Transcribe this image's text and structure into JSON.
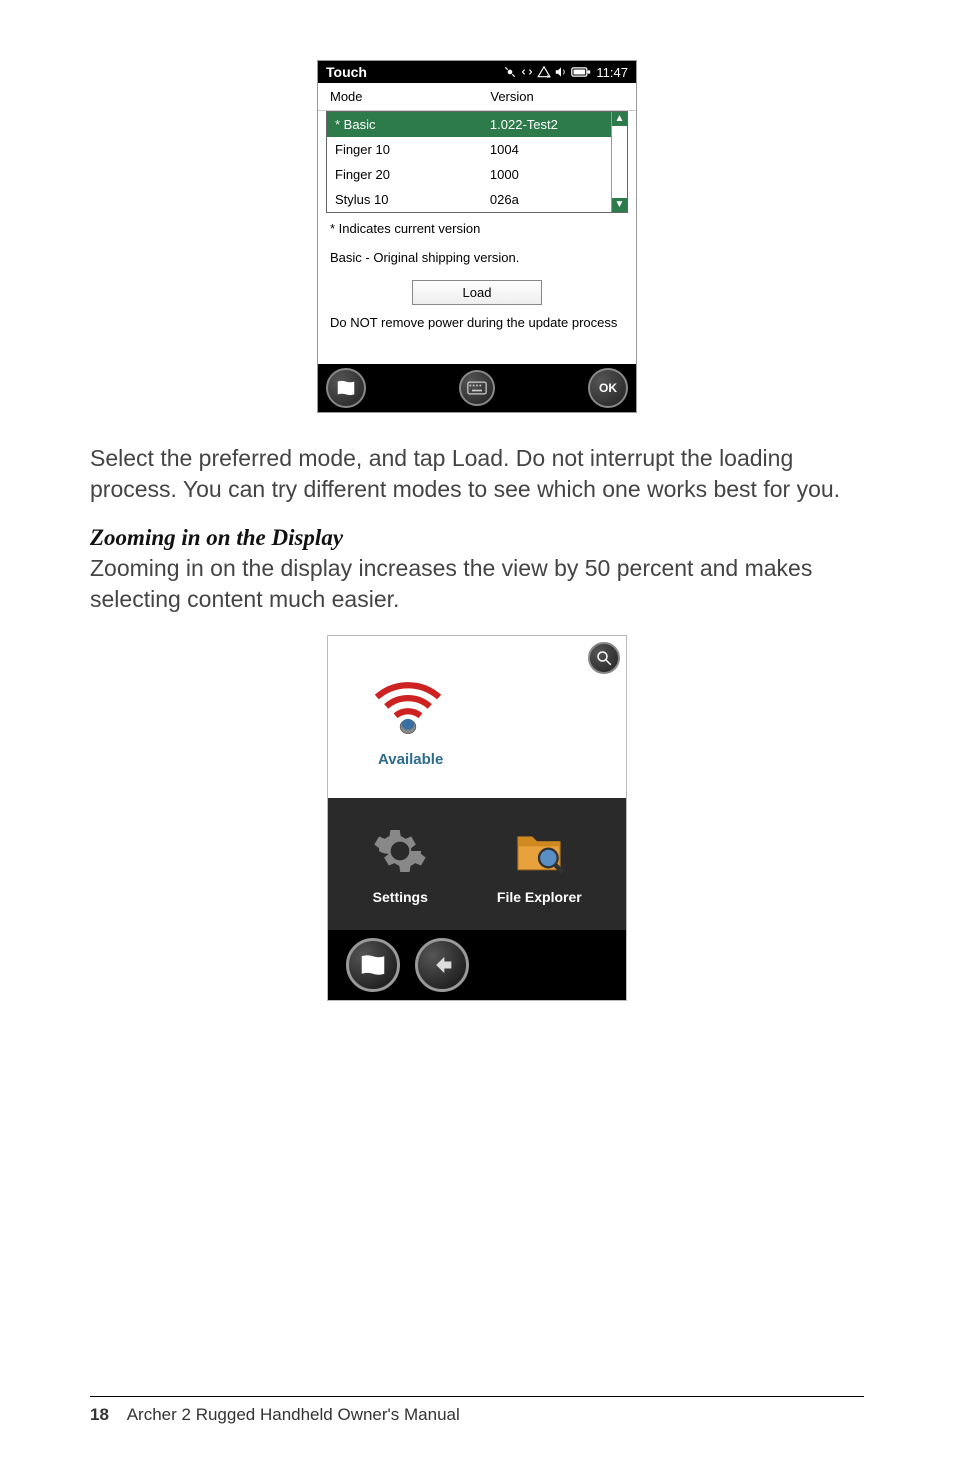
{
  "screenshot1": {
    "title": "Touch",
    "time": "11:47",
    "columns": {
      "mode": "Mode",
      "version": "Version"
    },
    "rows": [
      {
        "mode": "* Basic",
        "version": "1.022-Test2",
        "selected": true
      },
      {
        "mode": "Finger 10",
        "version": "1004",
        "selected": false
      },
      {
        "mode": "Finger 20",
        "version": "1000",
        "selected": false
      },
      {
        "mode": "Stylus 10",
        "version": "026a",
        "selected": false
      }
    ],
    "note1": "* Indicates current version",
    "note2": "Basic - Original shipping version.",
    "load": "Load",
    "warning": "Do NOT remove power during the update process",
    "ok": "OK"
  },
  "body": {
    "para1": "Select the preferred mode, and tap Load. Do not interrupt the loading process. You can try different modes to see which one works best for you.",
    "heading": "Zooming in on the Display",
    "para2": "Zooming in on the display increases the view by 50 percent and makes selecting content much easier."
  },
  "screenshot2": {
    "wifi_label": "Available",
    "tiles": {
      "settings": "Settings",
      "explorer": "File Explorer"
    }
  },
  "footer": {
    "page": "18",
    "doc": "Archer 2 Rugged Handheld Owner's Manual"
  }
}
